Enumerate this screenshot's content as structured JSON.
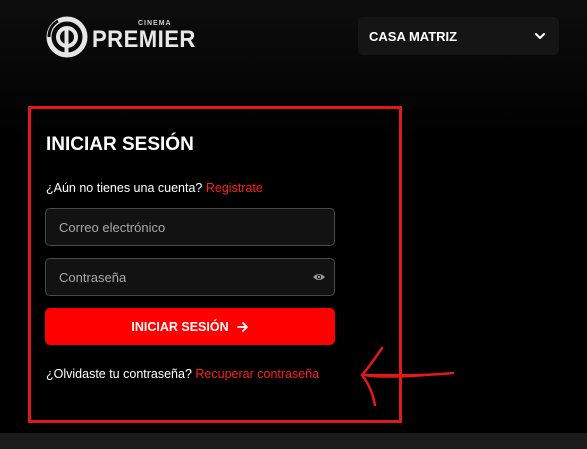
{
  "header": {
    "logo_small": "CINEMA",
    "logo_big": "PREMIER",
    "branch_select": {
      "value": "CASA MATRIZ",
      "icon": "chevron-down-icon"
    }
  },
  "login": {
    "title": "INICIAR SESIÓN",
    "no_account_text": "¿Aún no tienes una cuenta?",
    "register_link": "Registrate",
    "email": {
      "placeholder": "Correo electrónico",
      "value": ""
    },
    "password": {
      "placeholder": "Contraseña",
      "value": "",
      "icon": "eye-icon"
    },
    "submit_label": "INICIAR SESIÓN",
    "submit_icon": "arrow-right-icon",
    "forgot_text": "¿Olvidaste tu contraseña?",
    "recover_link": "Recuperar contraseña"
  },
  "colors": {
    "accent_red": "#ff0000",
    "annotation_red": "#e01a1a",
    "background": "#000000",
    "field_bg": "#121212"
  }
}
